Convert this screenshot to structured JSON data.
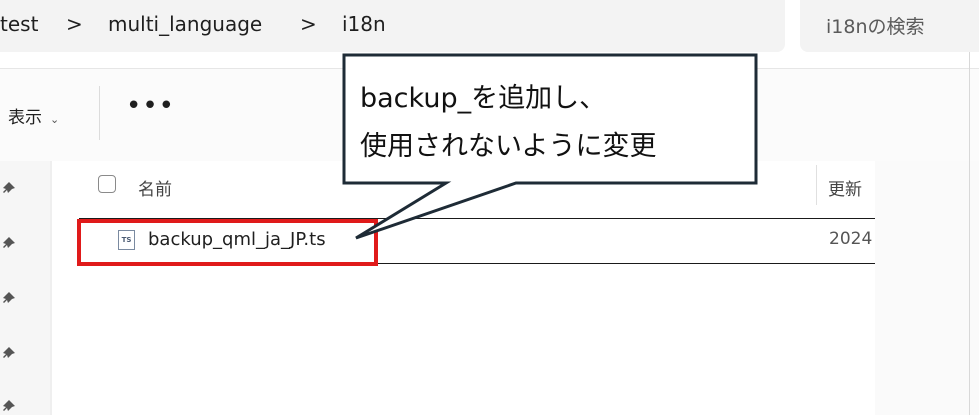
{
  "breadcrumb": {
    "items": [
      "test",
      "multi_language",
      "i18n"
    ],
    "separator": ">"
  },
  "search": {
    "placeholder": "i18nの検索"
  },
  "toolbar": {
    "view_label": "表示",
    "view_caret": "⌄",
    "more_label": "•••"
  },
  "columns": {
    "name": "名前",
    "modified": "更新"
  },
  "files": [
    {
      "icon_text": "TS",
      "name": "backup_qml_ja_JP.ts",
      "modified": "2024"
    }
  ],
  "callout": {
    "lines": [
      "backup_を追加し、",
      "使用されないように変更"
    ]
  },
  "colors": {
    "highlight": "#e01a1a",
    "callout_border": "#1e2b36"
  }
}
